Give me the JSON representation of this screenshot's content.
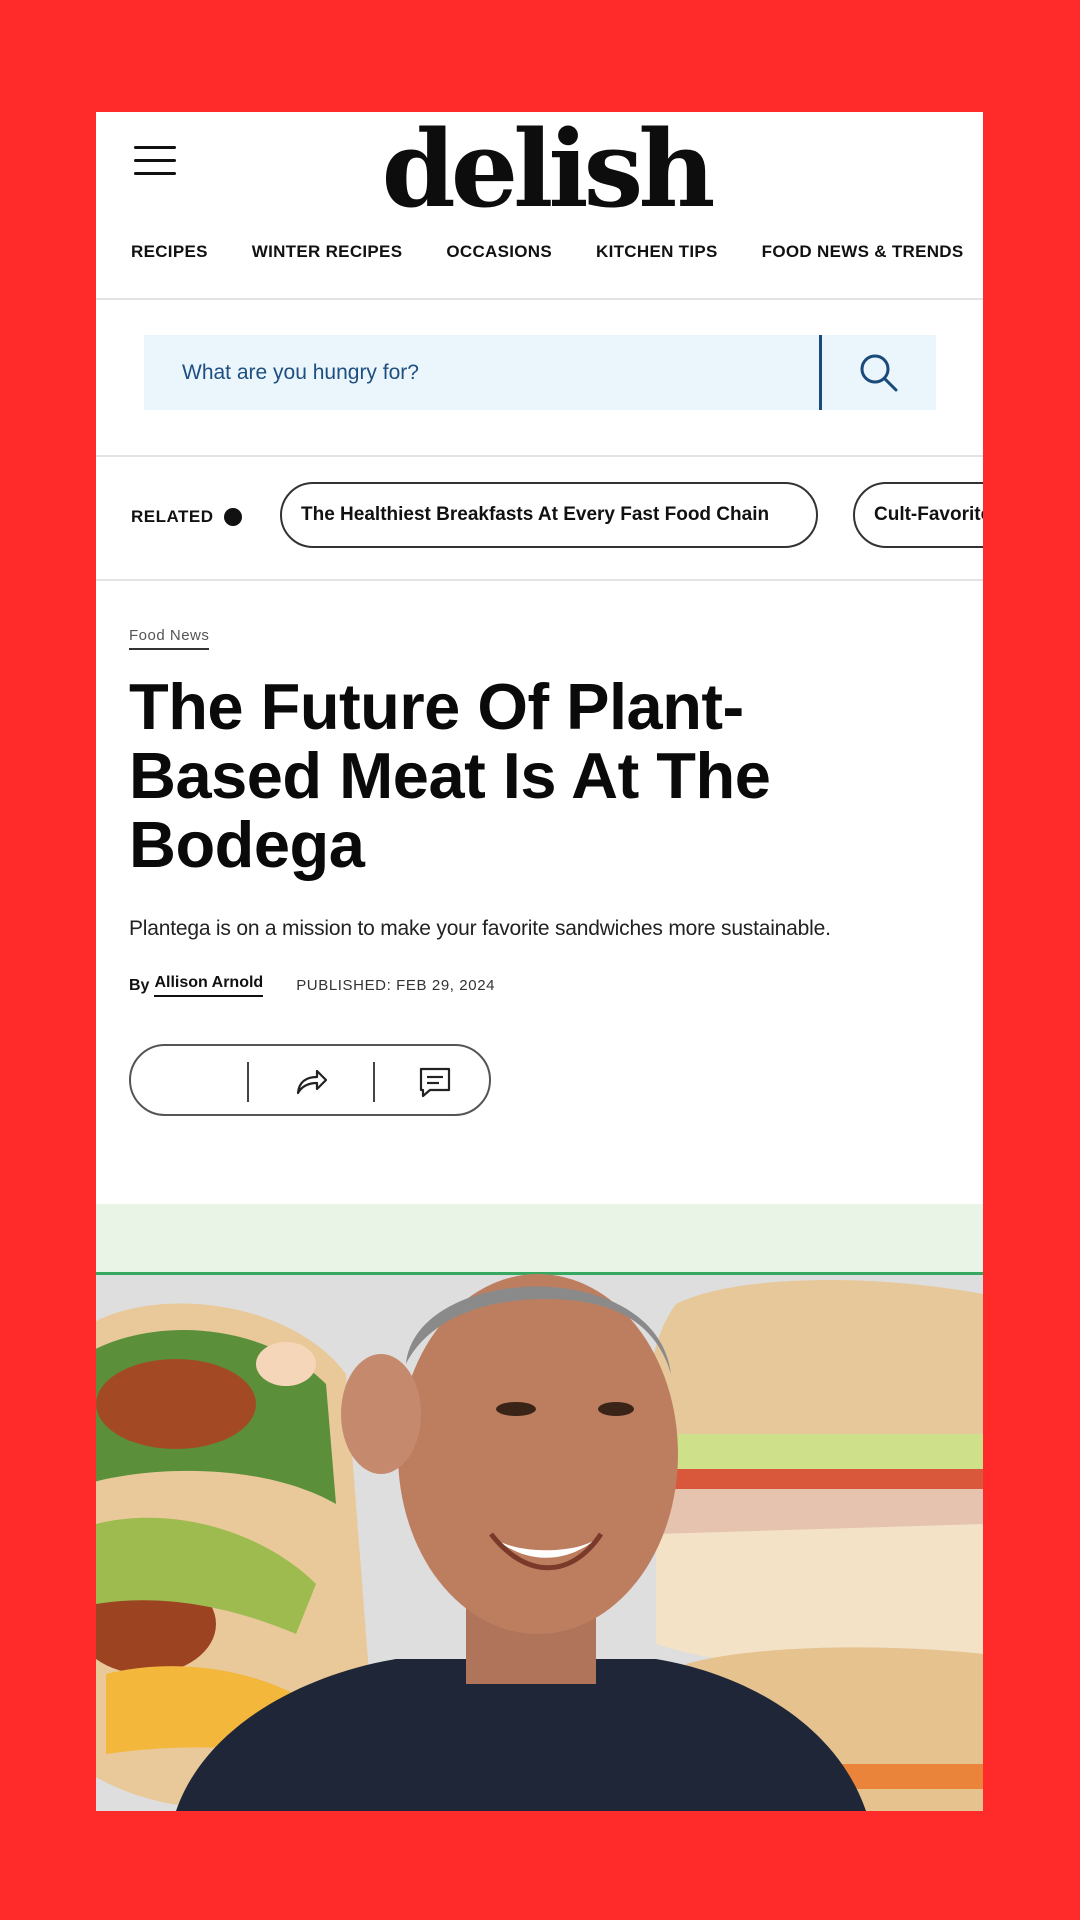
{
  "header": {
    "logo_text": "delish",
    "nav": [
      {
        "label": "RECIPES"
      },
      {
        "label": "WINTER RECIPES"
      },
      {
        "label": "OCCASIONS"
      },
      {
        "label": "KITCHEN TIPS"
      },
      {
        "label": "FOOD NEWS & TRENDS"
      }
    ]
  },
  "search": {
    "placeholder": "What are you hungry for?",
    "value": ""
  },
  "related": {
    "label": "RELATED",
    "items": [
      {
        "label": "The Healthiest Breakfasts At Every Fast Food Chain"
      },
      {
        "label": "Cult-Favorite"
      }
    ]
  },
  "article": {
    "category": "Food News",
    "headline": "The Future Of Plant-Based Meat Is At The Bodega",
    "dek": "Plantega is on a mission to make your favorite sandwiches more sustainable.",
    "by_label": "By",
    "author": "Allison Arnold",
    "published": "PUBLISHED: FEB 29, 2024"
  },
  "actions": {
    "icons": [
      "save-icon",
      "share-icon",
      "comment-icon"
    ]
  },
  "colors": {
    "background": "#ff2a2a",
    "search_bg": "#eaf5fc",
    "search_accent": "#1a4a7a"
  }
}
